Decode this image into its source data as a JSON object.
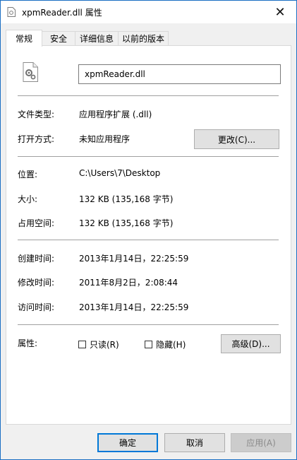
{
  "window": {
    "title": "xpmReader.dll 属性",
    "close_label": "✕"
  },
  "tabs": [
    {
      "label": "常规"
    },
    {
      "label": "安全"
    },
    {
      "label": "详细信息"
    },
    {
      "label": "以前的版本"
    }
  ],
  "general": {
    "file_name": "xpmReader.dll",
    "file_type": {
      "label": "文件类型:",
      "value": "应用程序扩展 (.dll)"
    },
    "open_with": {
      "label": "打开方式:",
      "value": "未知应用程序",
      "button": "更改(C)..."
    },
    "location": {
      "label": "位置:",
      "value": "C:\\Users\\7\\Desktop"
    },
    "size": {
      "label": "大小:",
      "value": "132 KB (135,168 字节)"
    },
    "size_on_disk": {
      "label": "占用空间:",
      "value": "132 KB (135,168 字节)"
    },
    "created": {
      "label": "创建时间:",
      "value": "2013年1月14日，22:25:59"
    },
    "modified": {
      "label": "修改时间:",
      "value": "2011年8月2日，2:08:44"
    },
    "accessed": {
      "label": "访问时间:",
      "value": "2013年1月14日，22:25:59"
    },
    "attributes": {
      "label": "属性:",
      "readonly": {
        "label": "只读(R)",
        "checked": false
      },
      "hidden": {
        "label": "隐藏(H)",
        "checked": false
      },
      "advanced_button": "高级(D)..."
    }
  },
  "footer": {
    "ok": "确定",
    "cancel": "取消",
    "apply": "应用(A)"
  },
  "colors": {
    "accent": "#0078d7",
    "border": "#1b6fc3"
  }
}
